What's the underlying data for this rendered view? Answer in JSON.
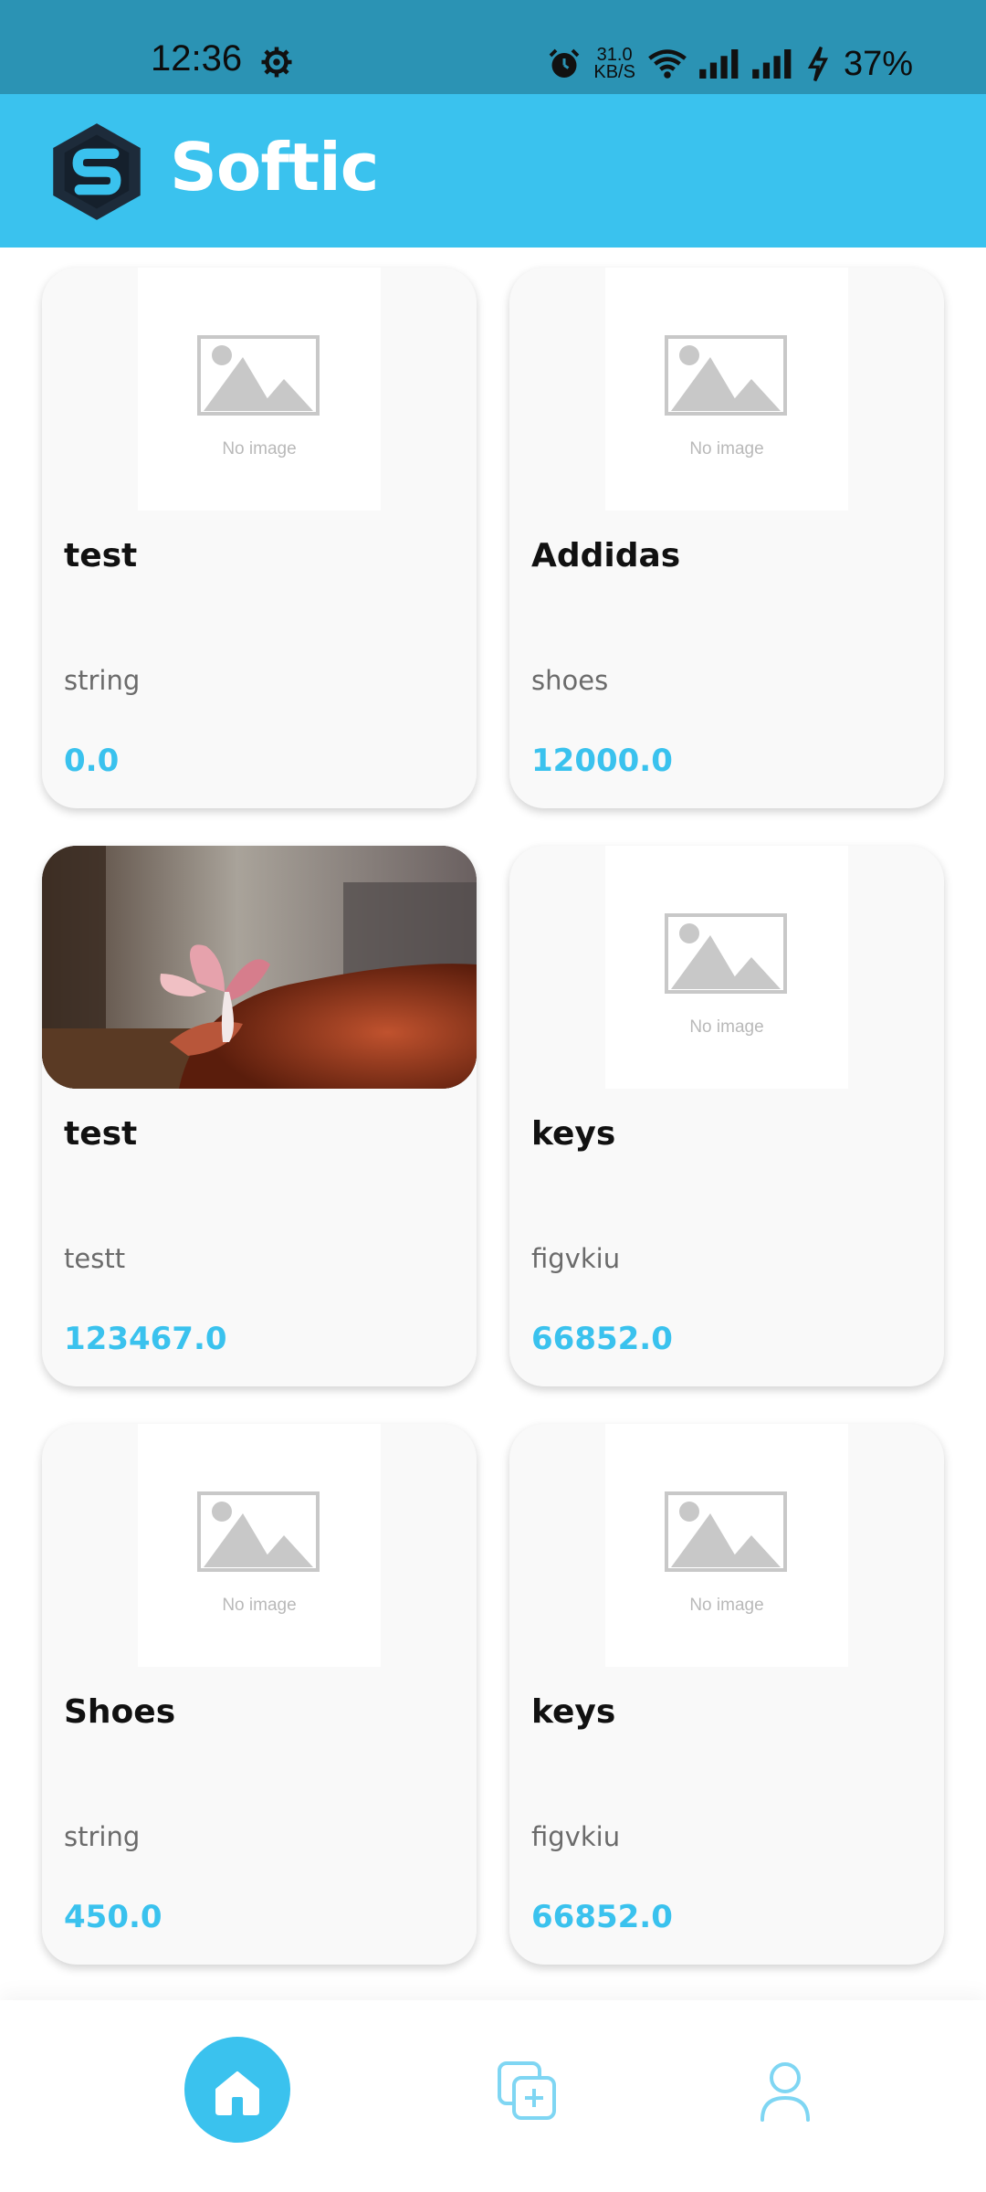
{
  "status_bar": {
    "time": "12:36",
    "net_speed_value": "31.0",
    "net_speed_unit": "KB/S",
    "battery": "37%"
  },
  "app_bar": {
    "title": "Softic",
    "brand_color": "#3ac2ee"
  },
  "placeholder_caption": "No image",
  "products": [
    {
      "title": "test",
      "description": "string",
      "price": "0.0",
      "image": "placeholder"
    },
    {
      "title": "Addidas",
      "description": "shoes",
      "price": "12000.0",
      "image": "placeholder"
    },
    {
      "title": "test",
      "description": "testt",
      "price": "123467.0",
      "image": "photo"
    },
    {
      "title": "keys",
      "description": "figvkiu",
      "price": "66852.0",
      "image": "placeholder"
    },
    {
      "title": "Shoes",
      "description": "string",
      "price": "450.0",
      "image": "placeholder"
    },
    {
      "title": "keys",
      "description": "figvkiu",
      "price": "66852.0",
      "image": "placeholder"
    }
  ],
  "bottom_nav": {
    "items": [
      "home-icon",
      "add-product-icon",
      "profile-icon"
    ],
    "active": "home"
  }
}
